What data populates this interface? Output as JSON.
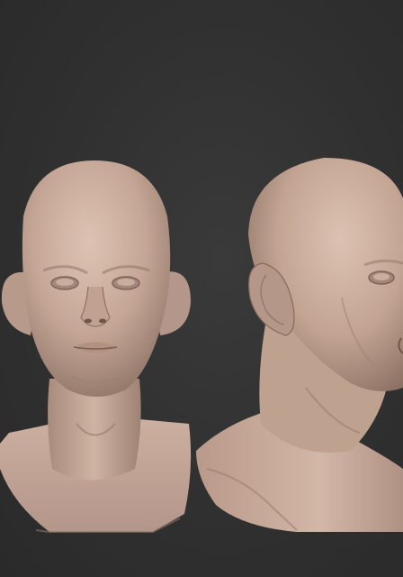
{
  "scene": {
    "background_color": "#2f2f2f",
    "model_color": "#c8aa9a",
    "views": [
      {
        "name": "front-view"
      },
      {
        "name": "three-quarter-view"
      }
    ]
  }
}
